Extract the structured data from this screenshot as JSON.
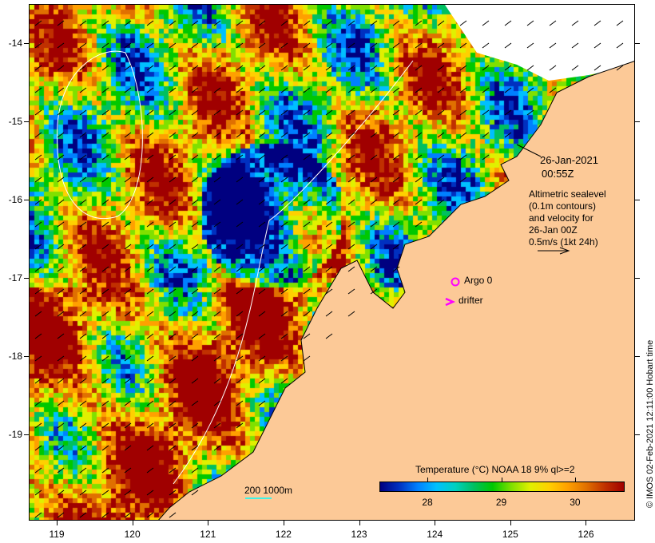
{
  "map": {
    "x_axis": {
      "ticks": [
        "119",
        "120",
        "121",
        "122",
        "123",
        "124",
        "125",
        "126"
      ],
      "values": [
        119,
        120,
        121,
        122,
        123,
        124,
        125,
        126
      ],
      "range": [
        118.63,
        126.65
      ]
    },
    "y_axis": {
      "ticks": [
        "-14",
        "-15",
        "-16",
        "-17",
        "-18",
        "-19"
      ],
      "values": [
        -14,
        -15,
        -16,
        -17,
        -18,
        -19
      ],
      "range": [
        -13.5,
        -20.1
      ]
    },
    "colors": {
      "land": "#fcc997",
      "missing": "#ffffff",
      "argo": "#ff00ff",
      "contour": "#ffffff",
      "bathy": "#00ffff"
    }
  },
  "annotation": {
    "date": "26-Jan-2021",
    "time": "00:55Z",
    "lines": [
      "Altimetric sealevel",
      "(0.1m contours)",
      "and velocity for",
      "26-Jan 00Z",
      "0.5m/s (1kt 24h)"
    ]
  },
  "legend": {
    "argo": "Argo 0",
    "drifter": "drifter",
    "depth_label": "200  1000m"
  },
  "colorbar": {
    "title": "Temperature (°C) NOAA 18 9% ql>=2",
    "ticks": [
      "28",
      "29",
      "30"
    ],
    "tick_values": [
      28,
      29,
      30
    ],
    "range": [
      27.35,
      30.65
    ]
  },
  "copyright": "© IMOS 02-Feb-2021 12:11:00 Hobart time"
}
